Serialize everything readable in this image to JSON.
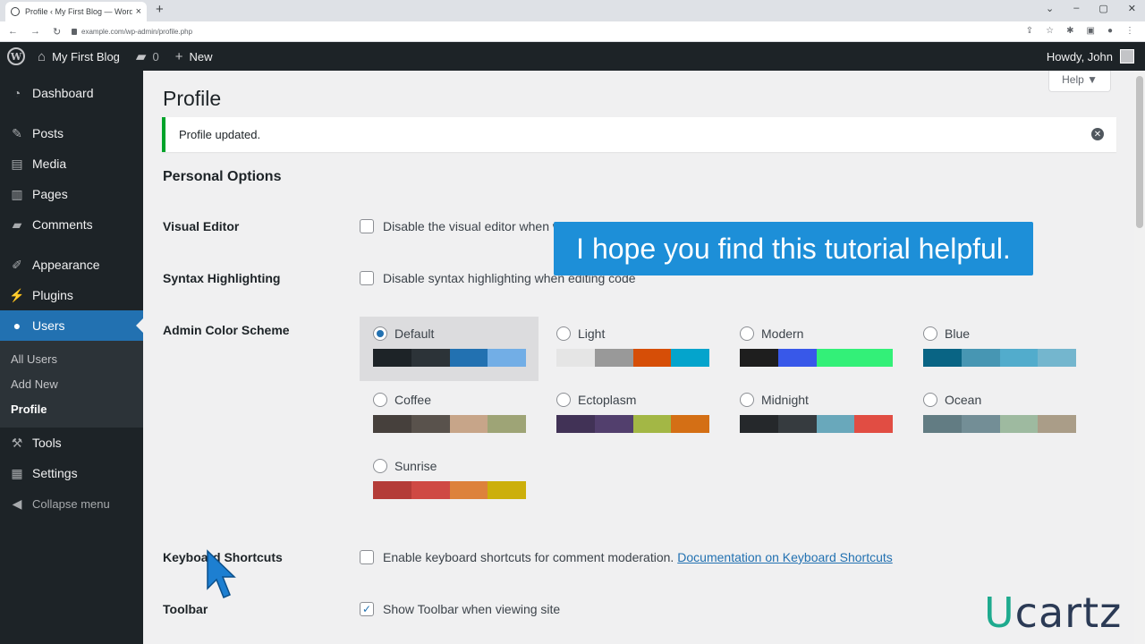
{
  "browser": {
    "tab_title": "Profile ‹ My First Blog — WordPress",
    "tab_close": "×",
    "new_tab": "+",
    "url": "example.com/wp-admin/profile.php"
  },
  "adminbar": {
    "site_name": "My First Blog",
    "comments_count": "0",
    "new_label": "New",
    "howdy": "Howdy, John"
  },
  "sidebar": {
    "items": [
      {
        "label": "Dashboard",
        "icon": "dashboard-icon"
      },
      {
        "label": "Posts",
        "icon": "pin-icon"
      },
      {
        "label": "Media",
        "icon": "media-icon"
      },
      {
        "label": "Pages",
        "icon": "pages-icon"
      },
      {
        "label": "Comments",
        "icon": "comments-icon"
      },
      {
        "label": "Appearance",
        "icon": "brush-icon"
      },
      {
        "label": "Plugins",
        "icon": "plug-icon"
      },
      {
        "label": "Users",
        "icon": "user-icon"
      }
    ],
    "submenu": [
      "All Users",
      "Add New",
      "Profile"
    ],
    "bottom": [
      {
        "label": "Tools",
        "icon": "wrench-icon"
      },
      {
        "label": "Settings",
        "icon": "settings-icon"
      },
      {
        "label": "Collapse menu",
        "icon": "collapse-icon"
      }
    ]
  },
  "main": {
    "help_label": "Help ▼",
    "title": "Profile",
    "notice": "Profile updated.",
    "section_title": "Personal Options",
    "visual_editor_label": "Visual Editor",
    "visual_editor_text": "Disable the visual editor when writing",
    "syntax_label": "Syntax Highlighting",
    "syntax_text": "Disable syntax highlighting when editing code",
    "color_scheme_label": "Admin Color Scheme",
    "keyboard_label": "Keyboard Shortcuts",
    "keyboard_text": "Enable keyboard shortcuts for comment moderation.",
    "keyboard_link": "Documentation on Keyboard Shortcuts",
    "toolbar_label": "Toolbar",
    "toolbar_text": "Show Toolbar when viewing site",
    "toolbar_checked": true,
    "check_mark": "✓"
  },
  "color_schemes": [
    {
      "name": "Default",
      "selected": true,
      "colors": [
        "#1d2327",
        "#2c3338",
        "#2271b1",
        "#72aee6"
      ]
    },
    {
      "name": "Light",
      "selected": false,
      "colors": [
        "#e5e5e5",
        "#999999",
        "#d64e07",
        "#04a4cc"
      ]
    },
    {
      "name": "Modern",
      "selected": false,
      "colors": [
        "#1e1e1e",
        "#3858e9",
        "#33f078",
        "#33f078"
      ]
    },
    {
      "name": "Blue",
      "selected": false,
      "colors": [
        "#096484",
        "#4796b3",
        "#52accc",
        "#74b6ce"
      ]
    },
    {
      "name": "Coffee",
      "selected": false,
      "colors": [
        "#46403c",
        "#59524c",
        "#c7a589",
        "#9ea476"
      ]
    },
    {
      "name": "Ectoplasm",
      "selected": false,
      "colors": [
        "#413256",
        "#523f6d",
        "#a3b745",
        "#d46f15"
      ]
    },
    {
      "name": "Midnight",
      "selected": false,
      "colors": [
        "#25282b",
        "#363b3f",
        "#69a8bb",
        "#e14d43"
      ]
    },
    {
      "name": "Ocean",
      "selected": false,
      "colors": [
        "#627c83",
        "#738e96",
        "#9ebaa0",
        "#aa9d88"
      ]
    },
    {
      "name": "Sunrise",
      "selected": false,
      "colors": [
        "#b43c38",
        "#cf4944",
        "#dd823b",
        "#ccaf0b"
      ]
    }
  ],
  "overlay": {
    "caption": "I hope you find this tutorial helpful.",
    "brand_u": "U",
    "brand_rest": "cartz"
  }
}
